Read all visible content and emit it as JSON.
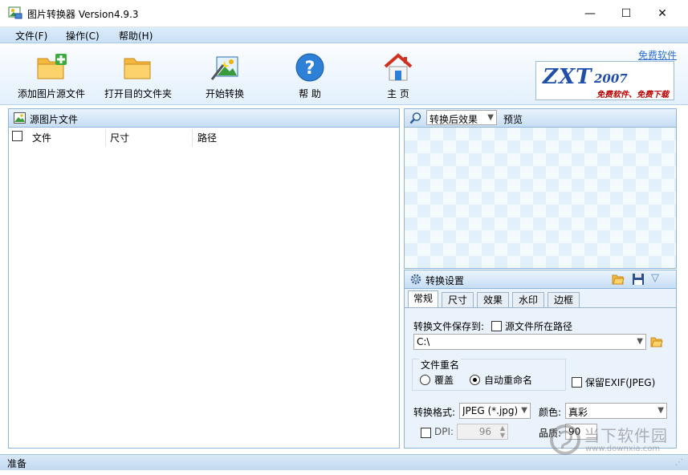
{
  "window": {
    "title": "图片转换器 Version4.9.3",
    "minimize_glyph": "—",
    "maximize_glyph": "☐",
    "close_glyph": "✕"
  },
  "menu": {
    "file": "文件(F)",
    "operate": "操作(C)",
    "help": "帮助(H)"
  },
  "toolbar": {
    "add_source": "添加图片源文件",
    "open_dest": "打开目的文件夹",
    "start_convert": "开始转换",
    "help": "帮 助",
    "home": "主 页"
  },
  "branding": {
    "free_link": "免费软件",
    "logo_main": "ZXT",
    "logo_year": "2007",
    "logo_sub": "免费软件、免费下载"
  },
  "source_panel": {
    "title": "源图片文件",
    "columns": [
      "文件",
      "尺寸",
      "路径"
    ]
  },
  "preview_panel": {
    "effect_select": "转换后效果",
    "preview_label": "预览"
  },
  "settings_panel": {
    "title": "转换设置",
    "tabs": [
      "常规",
      "尺寸",
      "效果",
      "水印",
      "边框"
    ],
    "active_tab": "常规",
    "save_to_label": "转换文件保存到:",
    "source_path_label": "源文件所在路径",
    "source_path_checked": false,
    "path_value": "C:\\",
    "rename_group": "文件重名",
    "overwrite_label": "覆盖",
    "auto_rename_label": "自动重命名",
    "rename_selected": "auto_rename",
    "keep_exif_label": "保留EXIF(JPEG)",
    "keep_exif_checked": false,
    "format_label": "转换格式:",
    "format_value": "JPEG (*.jpg)",
    "color_label": "颜色:",
    "color_value": "真彩",
    "dpi_label": "DPI:",
    "dpi_value": "96",
    "dpi_checked": false,
    "quality_label": "品质:",
    "quality_value": "90"
  },
  "status": {
    "text": "准备"
  },
  "watermark": {
    "site_name": "当下软件园",
    "site_url": "www.downxia.com"
  },
  "icons": {
    "app": "picture-icon",
    "add": "folder-plus-icon",
    "open": "folder-icon",
    "convert": "magic-wand-icon",
    "help": "question-icon",
    "home": "house-icon",
    "preview": "magnifier-icon",
    "settings": "gear-icon",
    "open_settings": "folder-open-icon",
    "save_settings": "floppy-icon",
    "collapse": "chevron-down-icon"
  },
  "colors": {
    "accent": "#2b6fd1",
    "panel_border": "#8eb5dc",
    "menu_bg": "#c9e0f6",
    "logo_blue": "#1f4fa8",
    "logo_red": "#b00000"
  }
}
